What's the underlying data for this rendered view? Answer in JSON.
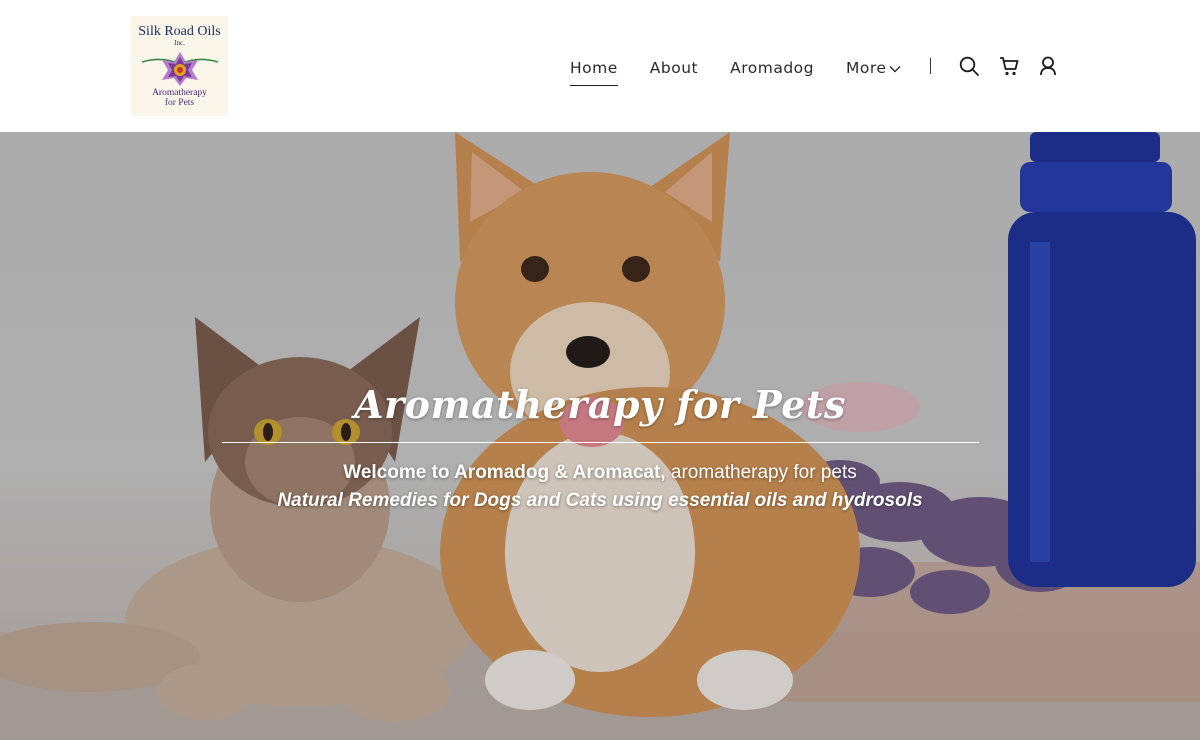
{
  "brand": {
    "logo_title": "Silk Road Oils",
    "logo_inc": "Inc.",
    "logo_subtitle_line1": "Aromatherapy",
    "logo_subtitle_line2": "for Pets"
  },
  "nav": {
    "items": [
      {
        "label": "Home",
        "active": true
      },
      {
        "label": "About",
        "active": false
      },
      {
        "label": "Aromadog",
        "active": false
      },
      {
        "label": "More",
        "active": false
      }
    ],
    "icons": [
      "search-icon",
      "cart-icon",
      "account-icon"
    ]
  },
  "hero": {
    "title": "Aromatherapy for Pets",
    "subtitle_bold": "Welcome to Aromadog & Aromacat,",
    "subtitle_rest": " aromatherapy for pets",
    "tagline": "Natural Remedies for Dogs and Cats using essential oils and hydrosols"
  },
  "colors": {
    "nav_text": "#2a2a2a",
    "logo_navy": "#1e2a66",
    "logo_purple": "#7a3b96",
    "bottle_blue": "#1a2f9e",
    "dog_fur": "#d59455",
    "lavender": "#6e5a86"
  }
}
